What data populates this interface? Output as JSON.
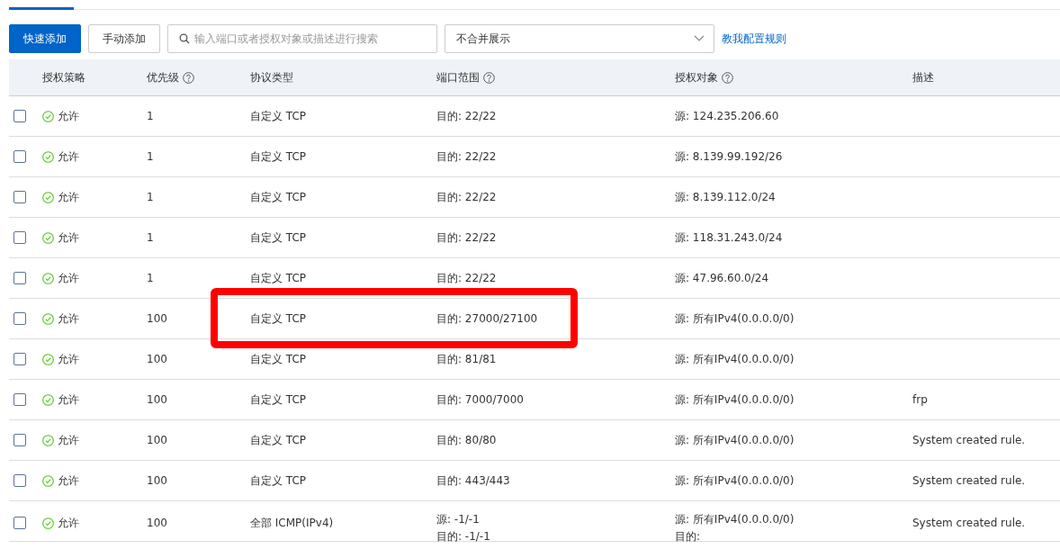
{
  "toolbar": {
    "primary_button": "快速添加",
    "secondary_button": "手动添加",
    "search": {
      "placeholder": "输入端口或者授权对象或描述进行搜索"
    },
    "select": {
      "value": "不合并展示"
    },
    "link": "教我配置规则"
  },
  "table": {
    "columns": [
      {
        "label": "授权策略",
        "help": false
      },
      {
        "label": "优先级",
        "help": true
      },
      {
        "label": "协议类型",
        "help": false
      },
      {
        "label": "端口范围",
        "help": true
      },
      {
        "label": "授权对象",
        "help": true
      },
      {
        "label": "描述",
        "help": false
      }
    ],
    "rows": [
      {
        "checked": false,
        "policy": "允许",
        "priority": "1",
        "protocol": "自定义 TCP",
        "port": [
          "目的: 22/22"
        ],
        "source": [
          "源: 124.235.206.60"
        ],
        "description": "",
        "highlighted": false
      },
      {
        "checked": false,
        "policy": "允许",
        "priority": "1",
        "protocol": "自定义 TCP",
        "port": [
          "目的: 22/22"
        ],
        "source": [
          "源: 8.139.99.192/26"
        ],
        "description": "",
        "highlighted": false
      },
      {
        "checked": false,
        "policy": "允许",
        "priority": "1",
        "protocol": "自定义 TCP",
        "port": [
          "目的: 22/22"
        ],
        "source": [
          "源: 8.139.112.0/24"
        ],
        "description": "",
        "highlighted": false
      },
      {
        "checked": false,
        "policy": "允许",
        "priority": "1",
        "protocol": "自定义 TCP",
        "port": [
          "目的: 22/22"
        ],
        "source": [
          "源: 118.31.243.0/24"
        ],
        "description": "",
        "highlighted": false
      },
      {
        "checked": false,
        "policy": "允许",
        "priority": "1",
        "protocol": "自定义 TCP",
        "port": [
          "目的: 22/22"
        ],
        "source": [
          "源: 47.96.60.0/24"
        ],
        "description": "",
        "highlighted": false
      },
      {
        "checked": false,
        "policy": "允许",
        "priority": "100",
        "protocol": "自定义 TCP",
        "port": [
          "目的: 27000/27100"
        ],
        "source": [
          "源: 所有IPv4(0.0.0.0/0)"
        ],
        "description": "",
        "highlighted": true
      },
      {
        "checked": false,
        "policy": "允许",
        "priority": "100",
        "protocol": "自定义 TCP",
        "port": [
          "目的: 81/81"
        ],
        "source": [
          "源: 所有IPv4(0.0.0.0/0)"
        ],
        "description": "",
        "highlighted": false
      },
      {
        "checked": false,
        "policy": "允许",
        "priority": "100",
        "protocol": "自定义 TCP",
        "port": [
          "目的: 7000/7000"
        ],
        "source": [
          "源: 所有IPv4(0.0.0.0/0)"
        ],
        "description": "frp",
        "highlighted": false
      },
      {
        "checked": false,
        "policy": "允许",
        "priority": "100",
        "protocol": "自定义 TCP",
        "port": [
          "目的: 80/80"
        ],
        "source": [
          "源: 所有IPv4(0.0.0.0/0)"
        ],
        "description": "System created rule.",
        "highlighted": false
      },
      {
        "checked": false,
        "policy": "允许",
        "priority": "100",
        "protocol": "自定义 TCP",
        "port": [
          "目的: 443/443"
        ],
        "source": [
          "源: 所有IPv4(0.0.0.0/0)"
        ],
        "description": "System created rule.",
        "highlighted": false
      },
      {
        "checked": false,
        "policy": "允许",
        "priority": "100",
        "protocol": "全部 ICMP(IPv4)",
        "port": [
          "源: -1/-1",
          "目的: -1/-1"
        ],
        "source": [
          "源: 所有IPv4(0.0.0.0/0)",
          "目的:"
        ],
        "description": "System created rule.",
        "highlighted": false
      }
    ]
  }
}
